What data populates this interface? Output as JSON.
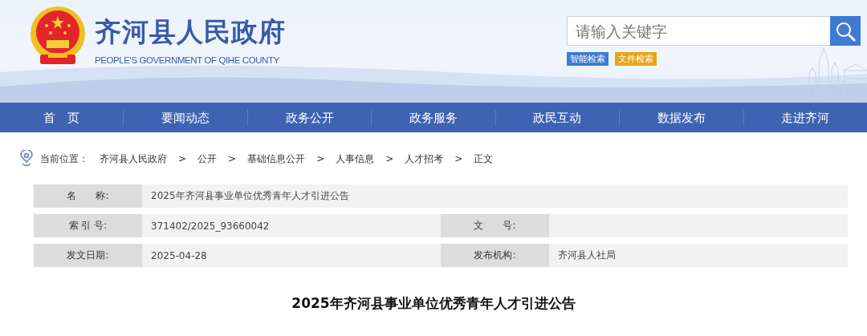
{
  "header": {
    "title": "齐河县人民政府",
    "subtitle": "PEOPLE'S GOVERNMENT OF QIHE COUNTY",
    "search": {
      "placeholder": "请输入关键字"
    },
    "search_tags": [
      {
        "label": "智能检索",
        "color": "#3d7bd4"
      },
      {
        "label": "文件检索",
        "color": "#e8a317"
      }
    ]
  },
  "nav": {
    "items": [
      {
        "label": "首　页"
      },
      {
        "label": "要闻动态"
      },
      {
        "label": "政务公开"
      },
      {
        "label": "政务服务"
      },
      {
        "label": "政民互动"
      },
      {
        "label": "数据发布"
      },
      {
        "label": "走进齐河"
      }
    ]
  },
  "breadcrumb": {
    "label": "当前位置：",
    "items": [
      "齐河县人民政府",
      "公开",
      "基础信息公开",
      "人事信息",
      "人才招考",
      "正文"
    ],
    "separator": ">"
  },
  "info_table": {
    "rows": [
      {
        "cells": [
          {
            "label": "名　　称:",
            "value": "2025年齐河县事业单位优秀青年人才引进公告"
          }
        ]
      },
      {
        "cells": [
          {
            "label": "索 引 号:",
            "value": "371402/2025_93660042"
          },
          {
            "label": "文　　号:"
          }
        ]
      },
      {
        "cells": [
          {
            "label": "发文日期:",
            "value": "2025-04-28"
          },
          {
            "label": "发布机构:",
            "value": "齐河县人社局"
          }
        ]
      }
    ]
  },
  "article": {
    "title": "2025年齐河县事业单位优秀青年人才引进公告"
  }
}
